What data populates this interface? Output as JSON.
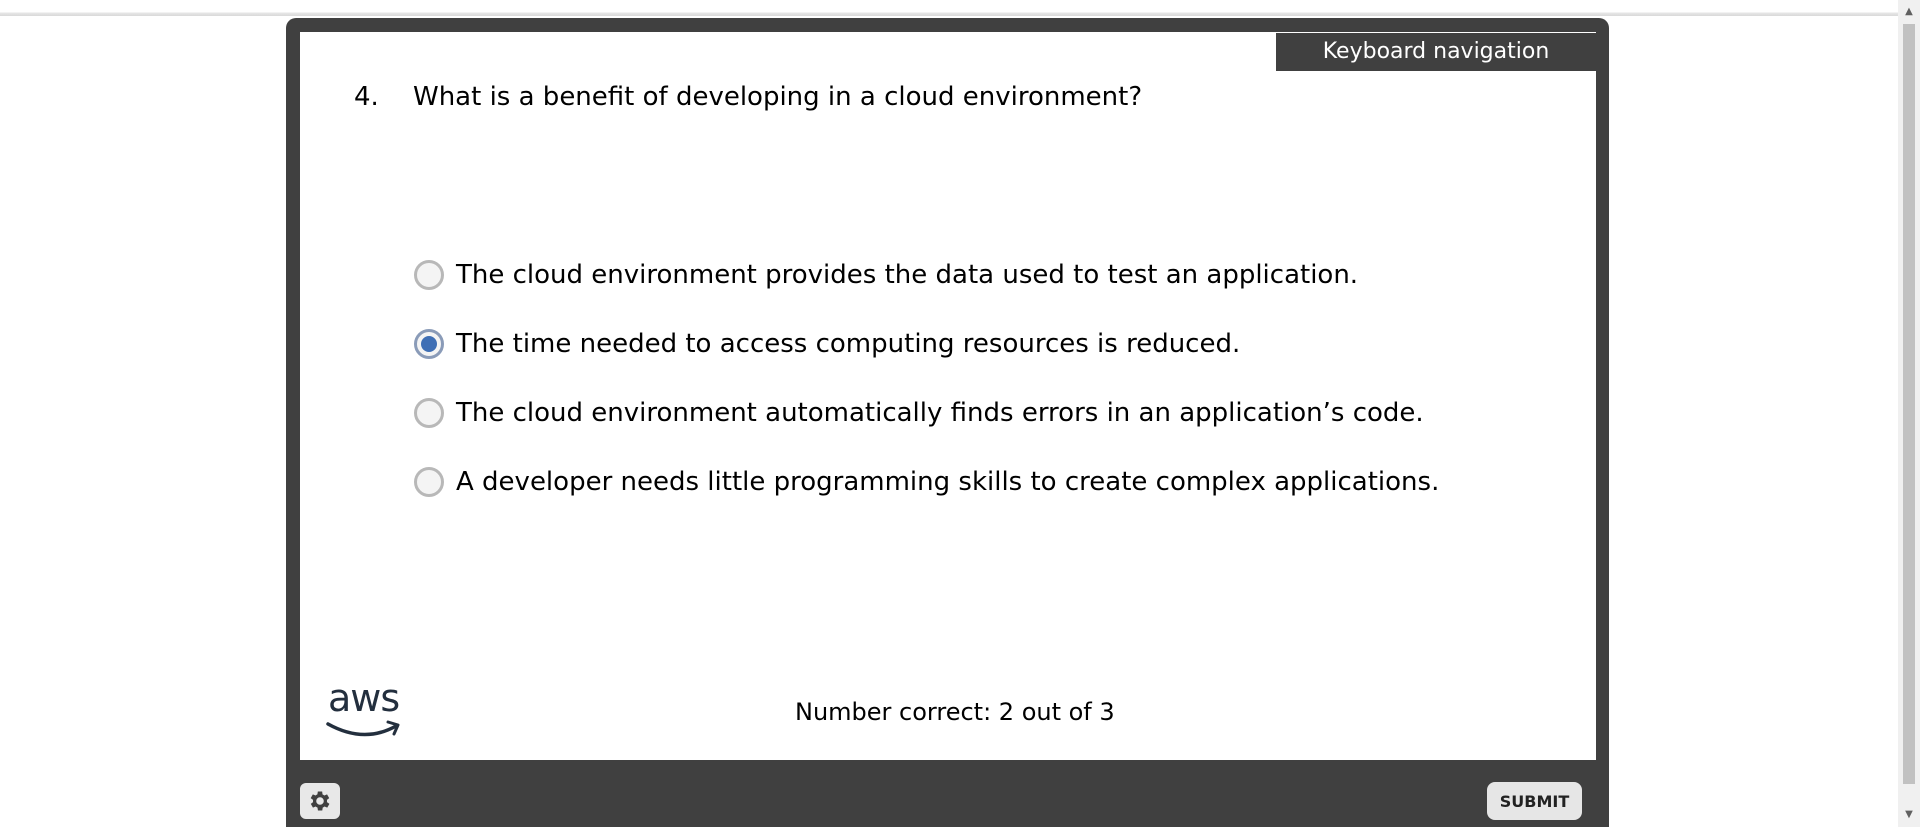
{
  "header": {
    "keyboard_nav_label": "Keyboard navigation"
  },
  "question": {
    "number": "4.",
    "text": "What is a benefit of developing in a cloud environment?"
  },
  "options": [
    {
      "label": "The cloud environment provides the data used to test an application.",
      "selected": false
    },
    {
      "label": "The time needed to access computing resources is reduced.",
      "selected": true
    },
    {
      "label": "The cloud environment automatically finds errors in an application’s code.",
      "selected": false
    },
    {
      "label": "A developer needs little programming skills to create complex applications.",
      "selected": false
    }
  ],
  "footer": {
    "logo_text": "aws",
    "score_text": "Number correct: 2 out of 3",
    "submit_label": "SUBMIT"
  },
  "colors": {
    "frame": "#404040",
    "radio_selected": "#3f6fb5"
  },
  "icons": {
    "settings": "gear-icon",
    "scroll_up": "scroll-up-icon",
    "scroll_down": "scroll-down-icon"
  }
}
